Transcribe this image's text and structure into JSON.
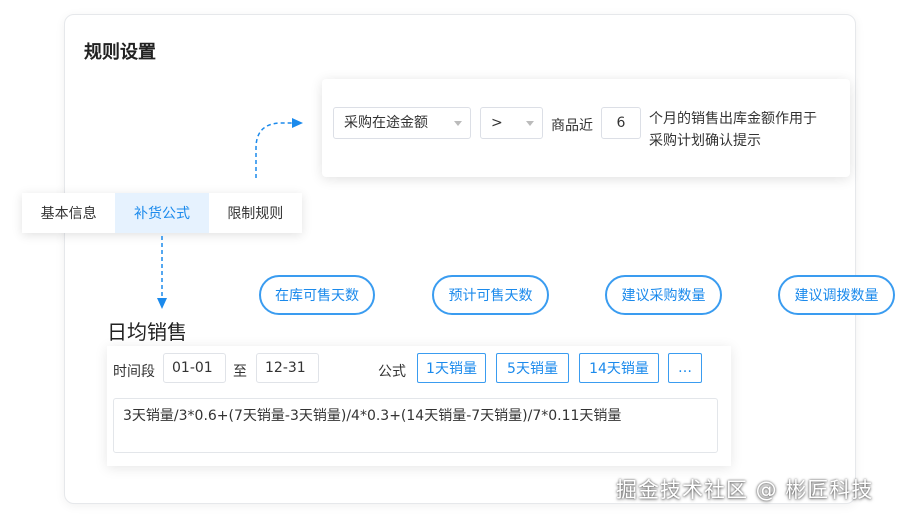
{
  "card": {
    "title": "规则设置"
  },
  "rule": {
    "metric_select": "采购在途金额",
    "operator_select": ">",
    "prefix": "商品近",
    "months_value": "6",
    "suffix_line1": "个月的销售出库金额作用于",
    "suffix_line2": "采购计划确认提示"
  },
  "tabs": [
    {
      "label": "基本信息",
      "active": false
    },
    {
      "label": "补货公式",
      "active": true
    },
    {
      "label": "限制规则",
      "active": false
    }
  ],
  "pills": [
    "在库可售天数",
    "预计可售天数",
    "建议采购数量",
    "建议调拨数量"
  ],
  "section": {
    "title": "日均销售"
  },
  "formula": {
    "period_label": "时间段",
    "start": "01-01",
    "to_label": "至",
    "end": "12-31",
    "formula_label": "公式",
    "vars": [
      "1天销量",
      "5天销量",
      "14天销量",
      "…"
    ],
    "expression": "3天销量/3*0.6+(7天销量-3天销量)/4*0.3+(14天销量-7天销量)/7*0.11天销量"
  },
  "watermark": "掘金技术社区 @ 彬匠科技",
  "colors": {
    "accent": "#1b8aec",
    "active_tab_bg": "#e6f2fe"
  }
}
